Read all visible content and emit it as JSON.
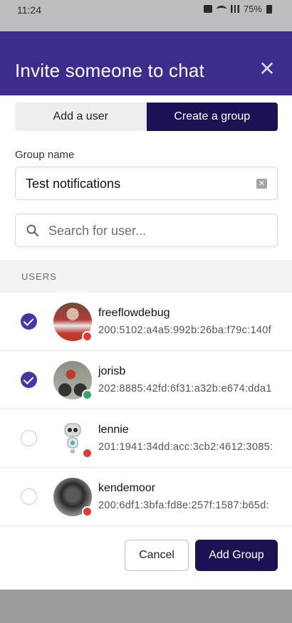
{
  "status_bar": {
    "time": "11:24",
    "battery": "75%"
  },
  "modal": {
    "title": "Invite someone to chat",
    "close_glyph": "✕",
    "header_color": "#3f2a8e"
  },
  "tabs": [
    {
      "label": "Add a user",
      "active": false
    },
    {
      "label": "Create a group",
      "active": true
    }
  ],
  "group": {
    "label": "Group name",
    "value": "Test notifications"
  },
  "search": {
    "placeholder": "Search for user..."
  },
  "users_section": {
    "header": "USERS",
    "users": [
      {
        "name": "freeflowdebug",
        "address": "200:5102:a4a5:992b:26ba:f79c:140f",
        "selected": true,
        "status": "offline",
        "status_color": "#e53935"
      },
      {
        "name": "jorisb",
        "address": "202:8885:42fd:6f31:a32b:e674:dda1",
        "selected": true,
        "status": "online",
        "status_color": "#27ae60"
      },
      {
        "name": "lennie",
        "address": "201:1941:34dd:acc:3cb2:4612:3085:",
        "selected": false,
        "status": "offline",
        "status_color": "#e53935"
      },
      {
        "name": "kendemoor",
        "address": "200:6df1:3bfa:fd8e:257f:1587:b65d:",
        "selected": false,
        "status": "offline",
        "status_color": "#e53935"
      }
    ]
  },
  "actions": {
    "cancel_label": "Cancel",
    "add_label": "Add Group"
  },
  "colors": {
    "accent": "#1d1253",
    "check": "#4b34a8"
  }
}
